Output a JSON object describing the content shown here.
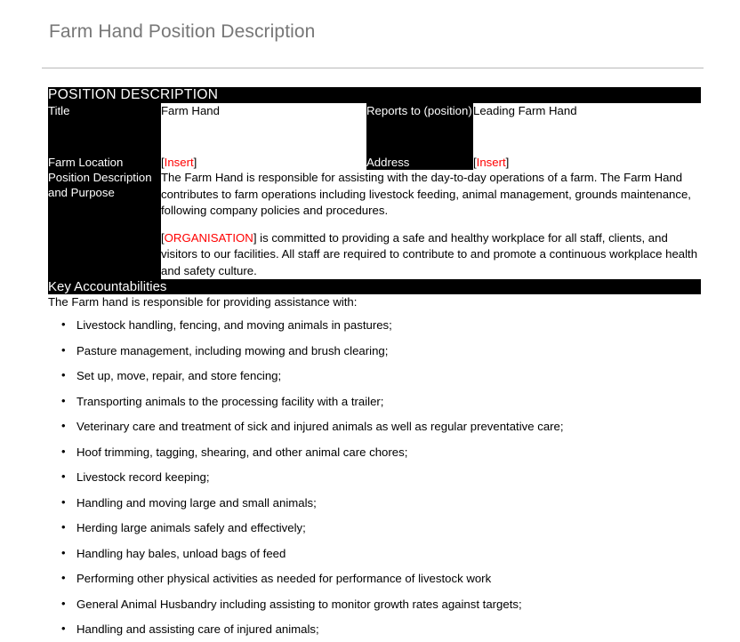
{
  "page": {
    "title": "Farm Hand Position Description"
  },
  "table": {
    "header": "POSITION DESCRIPTION",
    "rows": {
      "title_label": "Title",
      "title_value": "Farm Hand",
      "reports_label": "Reports to (position)",
      "reports_value": "Leading Farm Hand",
      "location_label": "Farm Location",
      "location_value_open": "[",
      "location_value_red": "Insert",
      "location_value_close": "]",
      "address_label": "Address",
      "address_value_open": "[",
      "address_value_red": "Insert",
      "address_value_close": "]",
      "purpose_label": "Position Description and Purpose",
      "purpose_paragraph_1": "The Farm Hand is responsible for assisting with the day-to-day operations of a farm. The Farm Hand contributes to farm operations including livestock feeding, animal management, grounds maintenance, following company policies and procedures.",
      "purpose_org_open": "[",
      "purpose_org_red": "ORGANISATION",
      "purpose_org_close": "]",
      "purpose_paragraph_2": " is committed to providing a safe and healthy workplace for all staff, clients, and visitors to our facilities. All staff are required to contribute to and promote a continuous workplace health and safety culture."
    }
  },
  "accountabilities": {
    "header": "Key Accountabilities",
    "intro": "The Farm hand is responsible for providing assistance with:",
    "items": [
      "Livestock handling, fencing, and moving animals in pastures;",
      "Pasture management, including mowing and brush clearing;",
      "Set up, move, repair, and store fencing;",
      "Transporting animals to the processing facility with a trailer;",
      "Veterinary care and treatment of sick and injured animals as well as regular preventative care;",
      "Hoof trimming, tagging, shearing, and other animal care chores;",
      "Livestock record keeping;",
      "Handling and moving large and small animals;",
      "Herding large animals safely and effectively;",
      "Handling hay bales, unload bags of feed",
      "Performing other physical activities as needed for performance of livestock work",
      "General Animal Husbandry including assisting to monitor growth rates against targets;",
      "Handling and assisting care of injured animals;"
    ]
  },
  "colors": {
    "placeholder_red": "#ff0000",
    "header_bar": "#000000",
    "title_text": "#777777"
  }
}
